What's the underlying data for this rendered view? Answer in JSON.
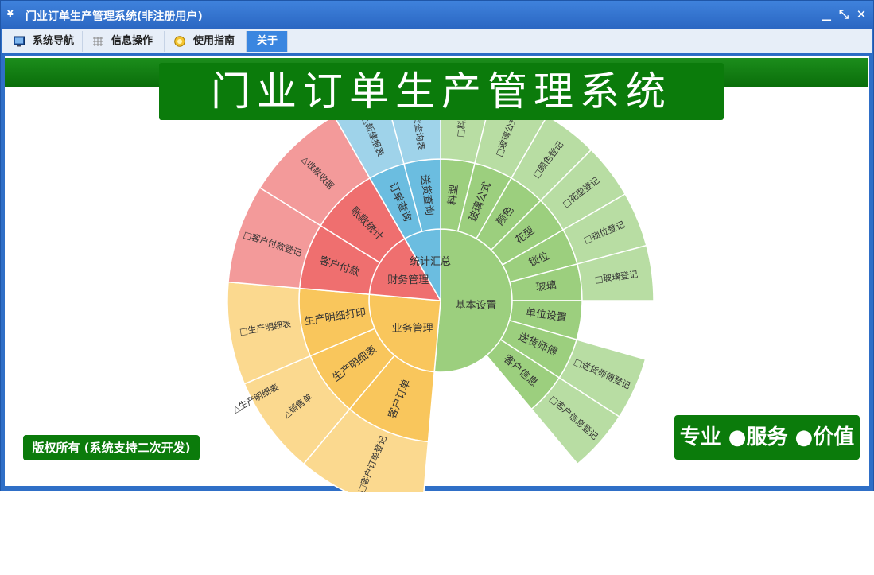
{
  "window": {
    "app_icon": "¥",
    "title": "门业订单生产管理系统(非注册用户)",
    "minimize_glyph": "▁",
    "restore_glyph": "⤡",
    "close_glyph": "✕"
  },
  "menu": [
    {
      "label": "系统导航",
      "icon": "monitor-icon"
    },
    {
      "label": "信息操作",
      "icon": "grid-icon"
    },
    {
      "label": "使用指南",
      "icon": "help-icon"
    },
    {
      "label": "关于",
      "icon": ""
    }
  ],
  "banner": {
    "title": "门业订单生产管理系统"
  },
  "footer": {
    "copyright": "版权所有 (系统支持二次开发)",
    "slogan": "专业 ●服务 ●价值"
  },
  "colors": {
    "green": "#9ccf7e",
    "green_light": "#b8dda3",
    "blue": "#6bbde0",
    "blue_light": "#9fd3ea",
    "red": "#ef6f6f",
    "red_light": "#f39a9a",
    "yellow": "#f9c65c",
    "yellow_light": "#fbd98f"
  },
  "sunburst": {
    "groups": [
      {
        "name": "基本设置",
        "color": "green",
        "a0": -90,
        "a1": 95,
        "children": [
          {
            "name": "料型",
            "a0": -90,
            "a1": -76,
            "leaf": "□料型"
          },
          {
            "name": "玻璃公式",
            "a0": -76,
            "a1": -60,
            "leaf": "□玻璃公式"
          },
          {
            "name": "颜色",
            "a0": -60,
            "a1": -45,
            "leaf": "□颜色登记"
          },
          {
            "name": "花型",
            "a0": -45,
            "a1": -30,
            "leaf": "□花型登记"
          },
          {
            "name": "锁位",
            "a0": -30,
            "a1": -15,
            "leaf": "□锁位登记"
          },
          {
            "name": "玻璃",
            "a0": -15,
            "a1": 0,
            "leaf": "□玻璃登记"
          },
          {
            "name": "单位设置",
            "a0": 0,
            "a1": 16,
            "leaf": ""
          },
          {
            "name": "送货师傅",
            "a0": 16,
            "a1": 33,
            "leaf": "□送货师傅登记"
          },
          {
            "name": "客户信息",
            "a0": 33,
            "a1": 50,
            "leaf": "□客户信息登记"
          }
        ]
      },
      {
        "name": "业务管理",
        "color": "yellow",
        "a0": 95,
        "a1": 185,
        "children": [
          {
            "name": "客户订单",
            "a0": 95,
            "a1": 130,
            "leaf": "□客户订单登记"
          },
          {
            "name": "生产明细表",
            "a0": 130,
            "a1": 157,
            "leaf": "△销售单"
          },
          {
            "name": "生产明细打印",
            "a0": 157,
            "a1": 185,
            "leaf": "□生产明细表"
          }
        ]
      },
      {
        "name": "财务管理",
        "color": "red",
        "a0": 185,
        "a1": 240,
        "children": [
          {
            "name": "客户付款",
            "a0": 185,
            "a1": 212,
            "leaf": "□客户付款登记"
          },
          {
            "name": "账款统计",
            "a0": 212,
            "a1": 240,
            "leaf": "△收款收据"
          }
        ]
      },
      {
        "name": "统计汇总",
        "color": "blue",
        "a0": 240,
        "a1": 270,
        "children": [
          {
            "name": "订单查询",
            "a0": 240,
            "a1": 255,
            "leaf": "△新建报表"
          },
          {
            "name": "送货查询",
            "a0": 255,
            "a1": 270,
            "leaf": "△送货查询表"
          }
        ]
      }
    ],
    "extra_leaf_yellow": "△生产明细表"
  }
}
